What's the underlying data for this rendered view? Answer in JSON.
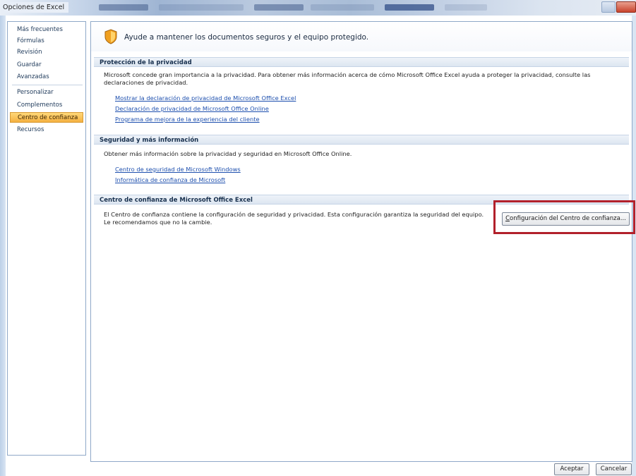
{
  "window": {
    "title": "Opciones de Excel"
  },
  "sidebar": {
    "items": [
      {
        "label": "Más frecuentes"
      },
      {
        "label": "Fórmulas"
      },
      {
        "label": "Revisión"
      },
      {
        "label": "Guardar"
      },
      {
        "label": "Avanzadas"
      },
      {
        "label": "Personalizar"
      },
      {
        "label": "Complementos"
      },
      {
        "label": "Centro de confianza",
        "selected": true
      },
      {
        "label": "Recursos"
      }
    ]
  },
  "header": {
    "icon": "shield-icon",
    "text": "Ayude a mantener los documentos seguros y el equipo protegido."
  },
  "privacy": {
    "title": "Protección de la privacidad",
    "line1": "Microsoft concede gran importancia a la privacidad. Para obtener más información acerca de cómo Microsoft Office Excel ayuda a proteger la privacidad, consulte las",
    "line2": "declaraciones de privacidad.",
    "links": [
      "Mostrar la declaración de privacidad de Microsoft Office Excel",
      "Declaración de privacidad de Microsoft Office Online",
      "Programa de mejora de la experiencia del cliente"
    ]
  },
  "security": {
    "title": "Seguridad y más información",
    "text": "Obtener más información sobre la privacidad y seguridad en Microsoft Office Online.",
    "links": [
      "Centro de seguridad de Microsoft Windows",
      "Informática de confianza de Microsoft"
    ]
  },
  "trust_center": {
    "title": "Centro de confianza de Microsoft Office Excel",
    "line1": "El Centro de confianza contiene la configuración de seguridad y privacidad. Esta configuración garantiza la seguridad del equipo.",
    "line2": "Le recomendamos que no la cambie.",
    "button_mnemonic": "C",
    "button_rest": "onfiguración del Centro de confianza...",
    "highlight_color": "#b2202b"
  },
  "footer": {
    "ok_label": "Aceptar",
    "cancel_label": "Cancelar"
  },
  "colors": {
    "selected_item": "#f4b041",
    "section_header": "#dde6f1",
    "link": "#1d4fae"
  }
}
